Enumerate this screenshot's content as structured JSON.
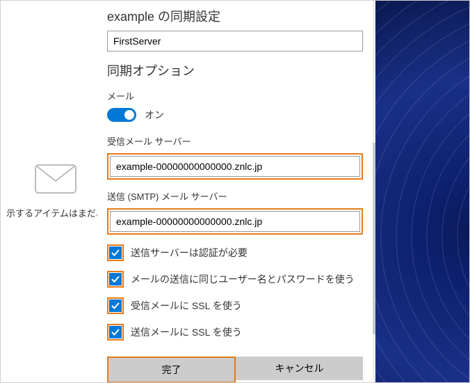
{
  "bg": {
    "left_text": "示するアイテムはまだあ"
  },
  "dialog": {
    "title": "example の同期設定",
    "account_name": "FirstServer",
    "sync_options_title": "同期オプション",
    "mail_label": "メール",
    "toggle_state": "オン",
    "incoming_label": "受信メール サーバー",
    "incoming_value": "example-00000000000000.znlc.jp",
    "outgoing_label": "送信 (SMTP) メール サーバー",
    "outgoing_value": "example-00000000000000.znlc.jp",
    "checkboxes": [
      {
        "label": "送信サーバーは認証が必要",
        "checked": true
      },
      {
        "label": "メールの送信に同じユーザー名とパスワードを使う",
        "checked": true
      },
      {
        "label": "受信メールに SSL を使う",
        "checked": true
      },
      {
        "label": "送信メールに SSL を使う",
        "checked": true
      }
    ],
    "buttons": {
      "done": "完了",
      "cancel": "キャンセル"
    }
  },
  "colors": {
    "accent": "#0078d7",
    "highlight": "#e87a1a"
  }
}
